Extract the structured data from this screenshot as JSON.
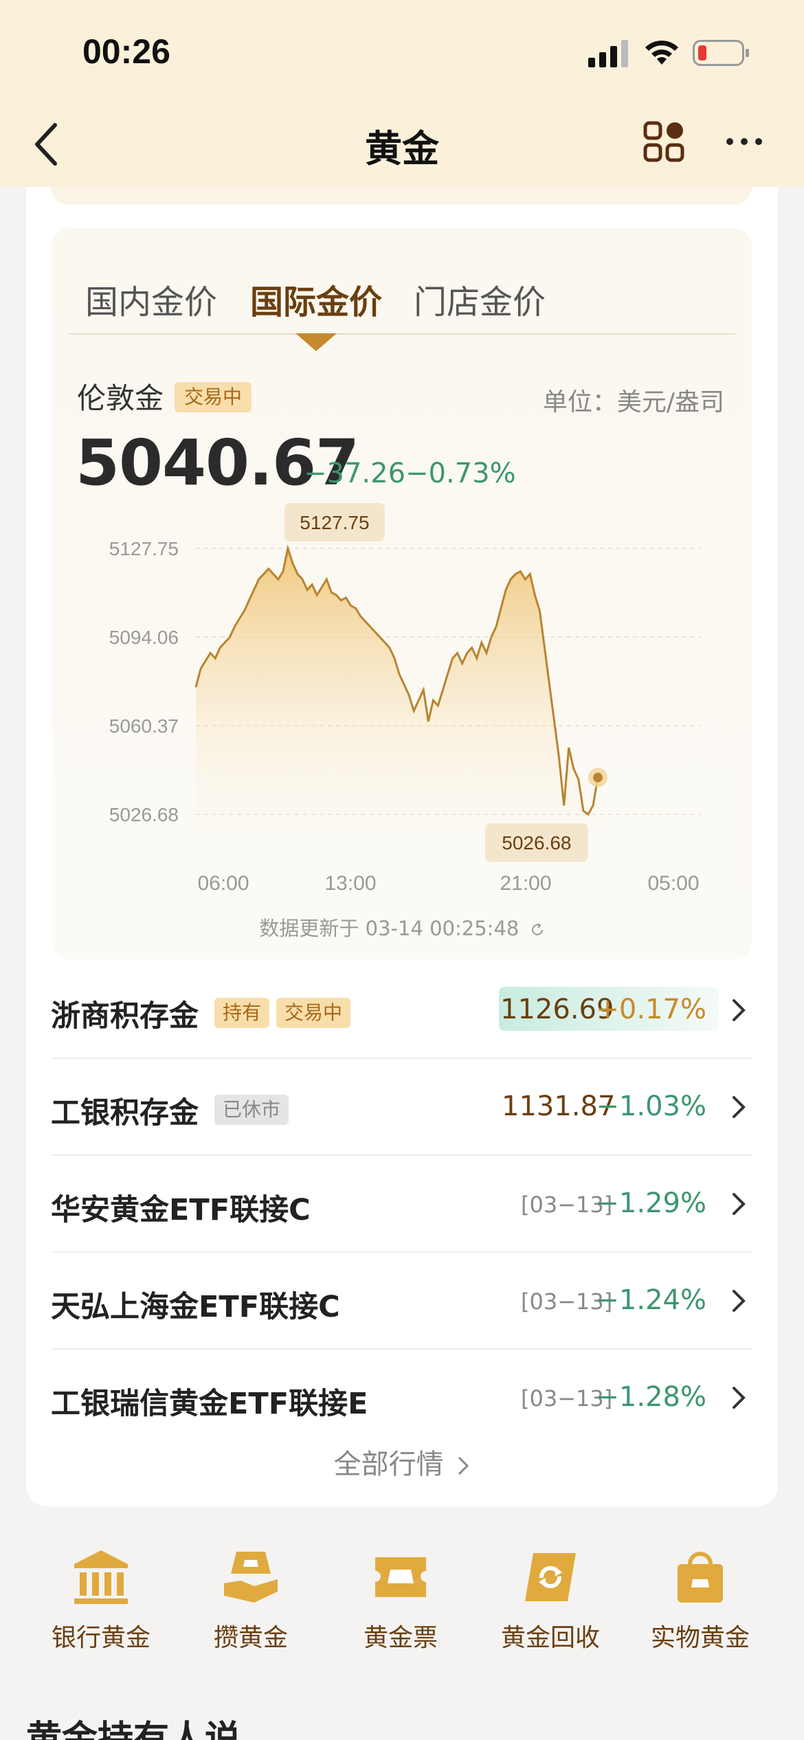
{
  "status_bar": {
    "time": "00:26"
  },
  "nav": {
    "title": "黄金"
  },
  "tabs": [
    {
      "label": "国内金价",
      "active": false
    },
    {
      "label": "国际金价",
      "active": true
    },
    {
      "label": "门店金价",
      "active": false
    }
  ],
  "quote": {
    "name": "伦敦金",
    "status": "交易中",
    "unit": "单位：美元/盎司",
    "price": "5040.67",
    "change": "−37.26",
    "change_pct": "−0.73%"
  },
  "chart_data": {
    "type": "area",
    "y_ticks": [
      "5127.75",
      "5094.06",
      "5060.37",
      "5026.68"
    ],
    "x_ticks": [
      "06:00",
      "13:00",
      "21:00",
      "05:00"
    ],
    "ylim": [
      5026.68,
      5127.75
    ],
    "high_label": "5127.75",
    "low_label": "5026.68",
    "line_color": "#b8842e",
    "values": [
      5075,
      5082,
      5085,
      5088,
      5086,
      5090,
      5092,
      5094,
      5098,
      5101,
      5104,
      5108,
      5112,
      5116,
      5118,
      5120,
      5118,
      5116,
      5119,
      5127.75,
      5122,
      5118,
      5116,
      5112,
      5114,
      5110,
      5113,
      5116,
      5111,
      5110,
      5108,
      5109,
      5106,
      5105,
      5102,
      5100,
      5098,
      5096,
      5094,
      5092,
      5090,
      5086,
      5080,
      5076,
      5072,
      5066,
      5070,
      5074,
      5062,
      5070,
      5068,
      5074,
      5080,
      5086,
      5088,
      5084,
      5088,
      5090,
      5086,
      5092,
      5088,
      5094,
      5098,
      5105,
      5112,
      5116,
      5118,
      5119,
      5116,
      5118,
      5110,
      5104,
      5090,
      5076,
      5062,
      5048,
      5030,
      5052,
      5044,
      5040,
      5028,
      5026.68,
      5030,
      5040.67
    ],
    "update_text": "数据更新于 03-14 00:25:48"
  },
  "products": [
    {
      "name": "浙商积存金",
      "badges": [
        "持有",
        "交易中"
      ],
      "value": "1126.69",
      "date": "",
      "pct": "+0.17%",
      "direction": "up"
    },
    {
      "name": "工银积存金",
      "badges": [
        "已休市"
      ],
      "value": "1131.87",
      "date": "",
      "pct": "−1.03%",
      "direction": "down"
    },
    {
      "name": "华安黄金ETF联接C",
      "badges": [],
      "value": "",
      "date": "[03−13]",
      "pct": "−1.29%",
      "direction": "down"
    },
    {
      "name": "天弘上海金ETF联接C",
      "badges": [],
      "value": "",
      "date": "[03−13]",
      "pct": "−1.24%",
      "direction": "down"
    },
    {
      "name": "工银瑞信黄金ETF联接E",
      "badges": [],
      "value": "",
      "date": "[03−13]",
      "pct": "−1.28%",
      "direction": "down"
    }
  ],
  "all_market": "全部行情",
  "shortcuts": [
    {
      "label": "银行黄金",
      "icon": "bank-icon"
    },
    {
      "label": "攒黄金",
      "icon": "coin-hand-icon"
    },
    {
      "label": "黄金票",
      "icon": "ticket-icon"
    },
    {
      "label": "黄金回收",
      "icon": "recycle-icon"
    },
    {
      "label": "实物黄金",
      "icon": "gold-bag-icon"
    }
  ],
  "section_title": "黄金持有人说",
  "colors": {
    "accent": "#c7892e",
    "down": "#3d9670",
    "header_bg": "#fbf1db"
  }
}
